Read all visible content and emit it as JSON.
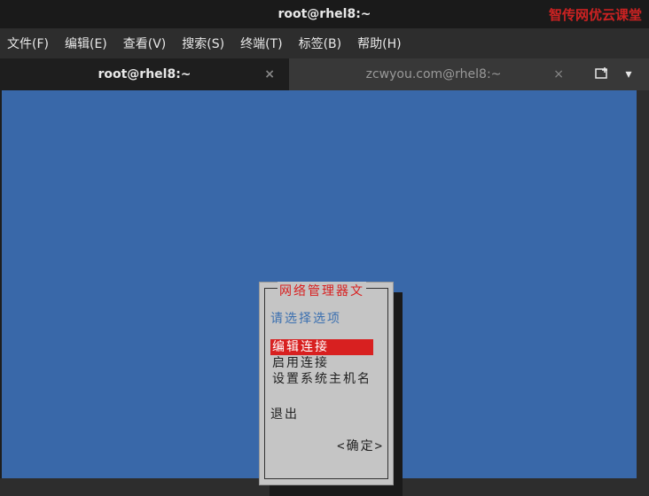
{
  "window": {
    "title": "root@rhel8:~",
    "watermark": "智传网优云课堂"
  },
  "menubar": {
    "items": [
      "文件(F)",
      "编辑(E)",
      "查看(V)",
      "搜索(S)",
      "终端(T)",
      "标签(B)",
      "帮助(H)"
    ]
  },
  "tabs": {
    "items": [
      {
        "label": "root@rhel8:~",
        "active": true
      },
      {
        "label": "zcwyou.com@rhel8:~",
        "active": false
      }
    ]
  },
  "dialog": {
    "title": "网络管理器文",
    "prompt": "请选择选项",
    "options": [
      {
        "label": "编辑连接",
        "selected": true
      },
      {
        "label": "启用连接",
        "selected": false
      },
      {
        "label": "设置系统主机名",
        "selected": false
      }
    ],
    "quit": "退出",
    "ok": "<确定>"
  }
}
